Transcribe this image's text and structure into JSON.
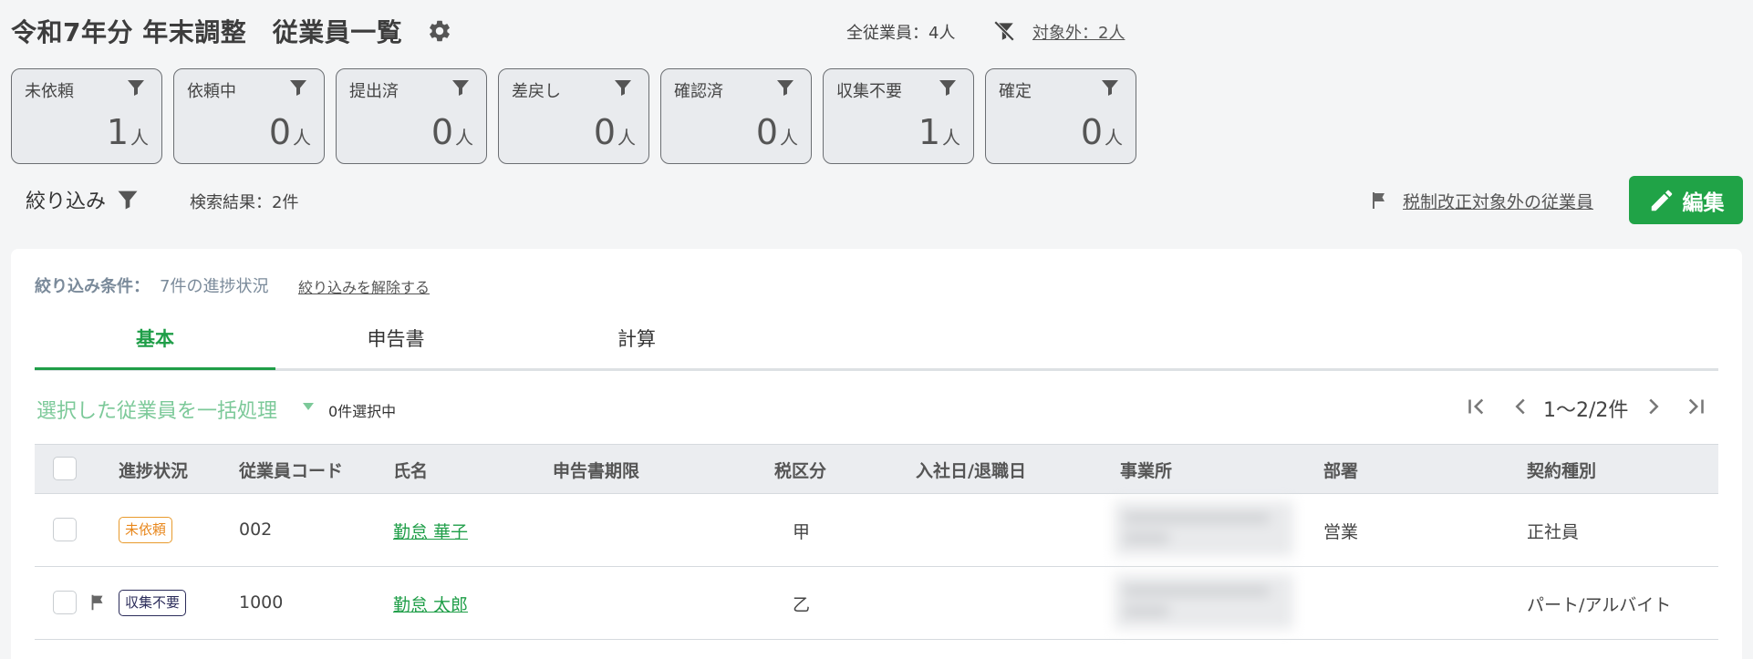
{
  "header": {
    "title": "令和7年分 年末調整　従業員一覧",
    "total_label": "全従業員：4人",
    "excluded_label": "対象外：2人"
  },
  "status_cards": [
    {
      "label": "未依頼",
      "count": "1",
      "unit": "人"
    },
    {
      "label": "依頼中",
      "count": "0",
      "unit": "人"
    },
    {
      "label": "提出済",
      "count": "0",
      "unit": "人"
    },
    {
      "label": "差戻し",
      "count": "0",
      "unit": "人"
    },
    {
      "label": "確認済",
      "count": "0",
      "unit": "人"
    },
    {
      "label": "収集不要",
      "count": "1",
      "unit": "人"
    },
    {
      "label": "確定",
      "count": "0",
      "unit": "人"
    }
  ],
  "toolbar": {
    "filter_label": "絞り込み",
    "search_result": "検索結果：2件",
    "tax_reform_link": "税制改正対象外の従業員",
    "edit_label": "編集"
  },
  "filter_conditions": {
    "label": "絞り込み条件：",
    "value": "7件の進捗状況",
    "clear_label": "絞り込みを解除する"
  },
  "tabs": [
    {
      "label": "基本",
      "active": true
    },
    {
      "label": "申告書",
      "active": false
    },
    {
      "label": "計算",
      "active": false
    }
  ],
  "bulk": {
    "label": "選択した従業員を一括処理",
    "selected_count": "0件選択中"
  },
  "pagination": {
    "text": "1〜2/2件"
  },
  "table": {
    "columns": [
      "進捗状況",
      "従業員コード",
      "氏名",
      "申告書期限",
      "税区分",
      "入社日/退職日",
      "事業所",
      "部署",
      "契約種別"
    ],
    "rows": [
      {
        "status": "未依頼",
        "status_color": "#e8871c",
        "flag": false,
        "code": "002",
        "name": "勤怠 華子",
        "deadline": "",
        "tax": "甲",
        "dates": "",
        "office": "",
        "department": "営業",
        "contract": "正社員"
      },
      {
        "status": "収集不要",
        "status_color": "#2b2c5a",
        "flag": true,
        "code": "1000",
        "name": "勤怠 太郎",
        "deadline": "",
        "tax": "乙",
        "dates": "",
        "office": "",
        "department": "",
        "contract": "パート/アルバイト"
      }
    ]
  },
  "colors": {
    "accent_green": "#1f9e48",
    "edit_button": "#20a347",
    "bulk_text": "#7cc999"
  },
  "icons": {
    "settings": "gear-icon",
    "filter": "filter-icon",
    "filter_off": "filter-off-icon",
    "flag": "flag-icon",
    "edit": "pencil-icon",
    "pager": [
      "first-page-icon",
      "prev-page-icon",
      "next-page-icon",
      "last-page-icon"
    ]
  }
}
